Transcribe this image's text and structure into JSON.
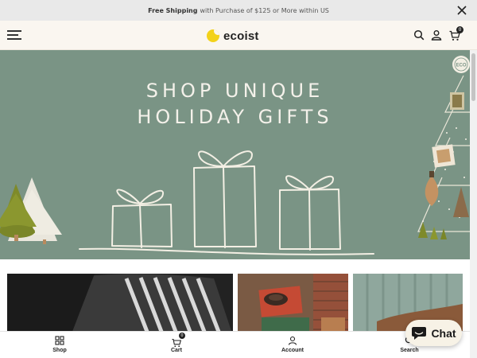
{
  "announcement": {
    "bold_text": "Free Shipping",
    "rest_text": "with Purchase of $125 or More within US"
  },
  "header": {
    "logo_text": "ecoist",
    "logo_color": "#f3d21a",
    "cart_count": "0",
    "icons": [
      "menu-icon",
      "search-icon",
      "account-icon",
      "cart-icon"
    ]
  },
  "hero": {
    "title_line1": "SHOP UNIQUE",
    "title_line2": "HOLIDAY GIFTS",
    "background_color": "#7a9485"
  },
  "bottom_nav": {
    "items": [
      {
        "label": "Shop",
        "icon": "grid-icon"
      },
      {
        "label": "Cart",
        "icon": "cart-icon",
        "badge": "0"
      },
      {
        "label": "Account",
        "icon": "user-icon"
      },
      {
        "label": "Search",
        "icon": "search-icon"
      }
    ]
  },
  "chat": {
    "label": "Chat"
  }
}
